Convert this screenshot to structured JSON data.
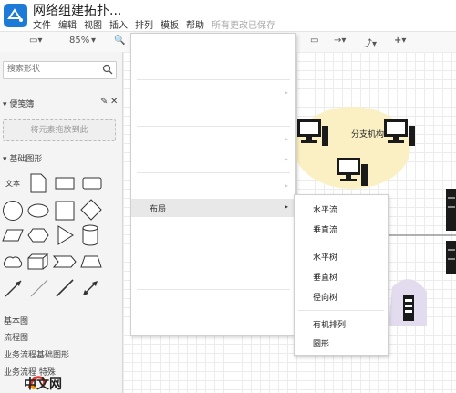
{
  "app": {
    "title": "网络组建拓扑...",
    "menu": [
      "文件",
      "编辑",
      "视图",
      "插入",
      "排列",
      "模板",
      "帮助"
    ],
    "save_status": "所有更改已保存"
  },
  "toolbar": {
    "zoom": "85%"
  },
  "sidebar": {
    "search_placeholder": "搜索形状",
    "scratchpad_title": "便笺簿",
    "scratchpad_drop": "将元素拖放到此",
    "general_title": "基础图形",
    "general_text_shape": "文本",
    "libraries": [
      "基本图",
      "流程图",
      "业务流程基础图形",
      "业务流程 特殊"
    ]
  },
  "canvas": {
    "branch_label": "分支机构"
  },
  "menu": {
    "items": [
      {
        "label": "",
        "shortcut": ""
      },
      {
        "label": "",
        "shortcut": ""
      },
      {
        "label": "",
        "shortcut": ""
      },
      {
        "label": "",
        "shortcut": ""
      },
      {
        "label": "",
        "shortcut": ""
      },
      {
        "label": "",
        "shortcut": ""
      },
      {
        "label": "",
        "shortcut": ""
      },
      {
        "label": "布局",
        "shortcut": ""
      },
      {
        "label": "",
        "shortcut": ""
      },
      {
        "label": "",
        "shortcut": ""
      },
      {
        "label": "",
        "shortcut": ""
      },
      {
        "label": "",
        "shortcut": ""
      },
      {
        "label": "",
        "shortcut": ""
      }
    ]
  },
  "submenu": {
    "items": [
      "水平流",
      "垂直流",
      "水平树",
      "垂直树",
      "径向树",
      "有机排列",
      "圆形"
    ]
  },
  "watermark": {
    "text": "中文网"
  }
}
